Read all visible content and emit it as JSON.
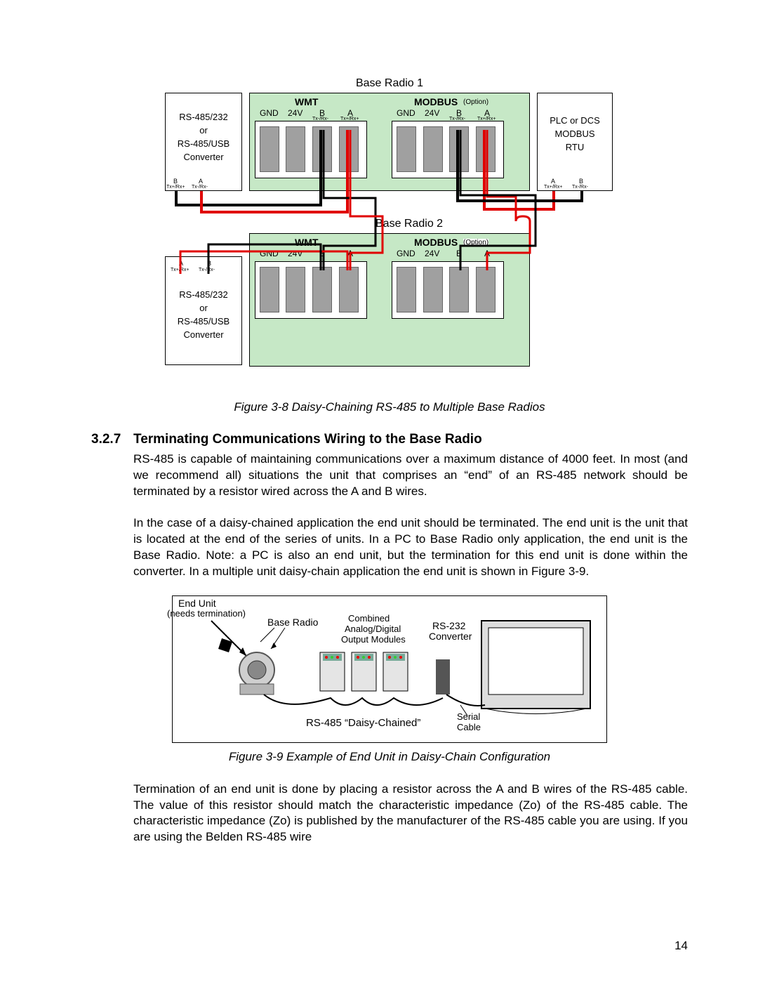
{
  "page_number": "14",
  "figure38": {
    "title_top": "Base Radio 1",
    "title_mid": "Base Radio 2",
    "caption": "Figure 3-8 Daisy-Chaining RS-485 to Multiple Base Radios",
    "converter_l1": "RS-485/232",
    "converter_l2": "or",
    "converter_l3": "RS-485/USB",
    "converter_l4": "Converter",
    "plc_l1": "PLC or DCS",
    "plc_l2": "MODBUS",
    "plc_l3": "RTU",
    "wmt": "WMT",
    "modbus": "MODBUS",
    "option": "(Option)",
    "gnd": "GND",
    "v24": "24V",
    "a": "A",
    "b": "B",
    "tx_rx_plus": "Tx+/Rx+",
    "tx_rx_minus": "Tx-/Rx-"
  },
  "section": {
    "number": "3.2.7",
    "title": "Terminating Communications Wiring to the Base Radio",
    "para1": "RS-485 is capable of maintaining communications over a maximum distance of 4000 feet. In most (and we recommend all) situations the unit that comprises an “end” of an RS-485 network should be terminated by a resistor wired across the A and B wires.",
    "para2": "In the case of a daisy-chained application the end unit should be terminated. The end unit is the unit that is located at the end of the series of units. In a PC to Base Radio only application, the end unit is the Base Radio. Note: a PC is also an end unit, but the termination for this end unit is done within the converter. In a multiple unit daisy-chain application the end unit is shown in Figure 3-9.",
    "para3": "Termination of an end unit is done by placing a resistor across the A and B wires of the RS-485 cable. The value of this resistor should match the characteristic impedance (Zo) of the RS-485 cable. The characteristic impedance (Zo) is published by the manufacturer of the RS-485 cable you are using. If you are using the Belden RS-485 wire"
  },
  "figure39": {
    "caption": "Figure 3-9 Example of End Unit in Daisy-Chain Configuration",
    "end_unit": "End Unit",
    "needs_term": "(needs termination)",
    "base_radio": "Base Radio",
    "combined": "Combined",
    "analog_digital": "Analog/Digital",
    "output_modules": "Output Modules",
    "rs232": "RS-232",
    "converter": "Converter",
    "pc": "PC",
    "daisy": "RS-485 “Daisy-Chained”",
    "serial": "Serial",
    "cable": "Cable"
  }
}
